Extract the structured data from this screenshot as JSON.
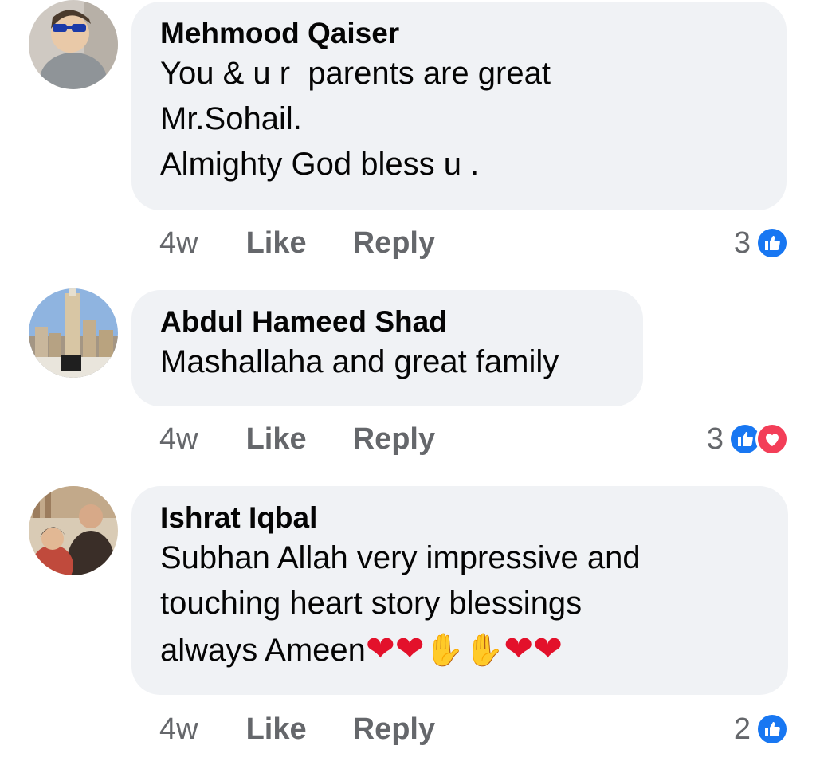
{
  "comments": [
    {
      "author": "Mehmood Qaiser",
      "lines": [
        "You & u r  parents are great",
        "Mr.Sohail.",
        "Almighty God bless u ."
      ],
      "time": "4w",
      "like_label": "Like",
      "reply_label": "Reply",
      "reaction_count": "3",
      "reactions": [
        "like-icon"
      ]
    },
    {
      "author": "Abdul Hameed Shad",
      "lines": [
        "Mashallaha and great family"
      ],
      "time": "4w",
      "like_label": "Like",
      "reply_label": "Reply",
      "reaction_count": "3",
      "reactions": [
        "like-icon",
        "love-icon"
      ]
    },
    {
      "author": "Ishrat Iqbal",
      "lines": [
        "Subhan Allah very impressive and",
        "touching heart story blessings",
        "always Ameen"
      ],
      "emoji_trail": [
        "heart",
        "heart",
        "raised-hands",
        "raised-hands",
        "heart",
        "heart"
      ],
      "time": "4w",
      "like_label": "Like",
      "reply_label": "Reply",
      "reaction_count": "2",
      "reactions": [
        "like-icon"
      ]
    }
  ],
  "colors": {
    "bubble": "#f0f2f5",
    "meta_text": "#65676b",
    "like_blue": "#1877f2",
    "love_red": "#f33e58"
  }
}
